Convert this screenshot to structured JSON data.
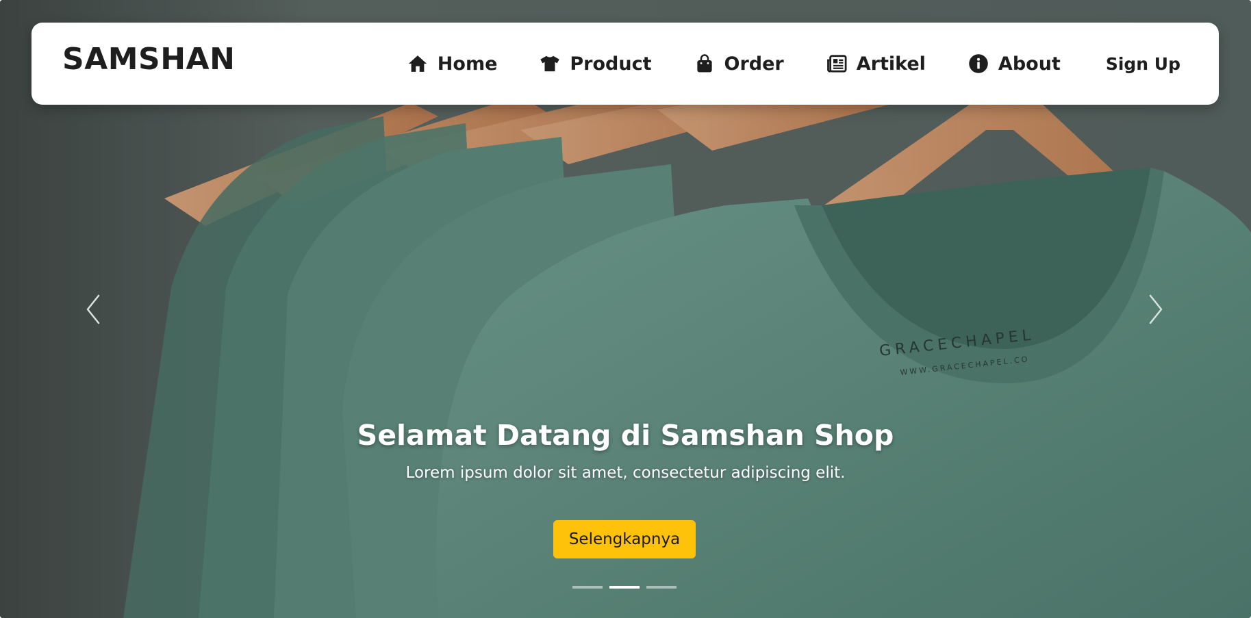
{
  "brand": {
    "name": "SAMSHAN"
  },
  "nav": {
    "items": [
      {
        "label": "Home",
        "icon": "home-icon"
      },
      {
        "label": "Product",
        "icon": "tshirt-icon"
      },
      {
        "label": "Order",
        "icon": "shopping-bag-icon"
      },
      {
        "label": "Artikel",
        "icon": "newspaper-icon"
      },
      {
        "label": "About",
        "icon": "info-circle-icon"
      }
    ],
    "signup_label": "Sign Up"
  },
  "hero": {
    "title": "Selamat Datang di Samshan Shop",
    "text": "Lorem ipsum dolor sit amet, consectetur adipiscing elit.",
    "button_label": "Selengkapnya",
    "prev_icon": "chevron-left-icon",
    "next_icon": "chevron-right-icon",
    "slide_count": 3,
    "active_slide": 2,
    "background_photo": "green-tshirts-on-wooden-hangers",
    "tag_text_1": "GRACECHAPEL",
    "tag_text_2": "WWW.GRACECHAPEL.CO"
  },
  "colors": {
    "button": "#ffc20a",
    "navbar_bg": "#ffffff",
    "text_dark": "#1e1e1e",
    "shirt_green": "#5e8a7d"
  }
}
